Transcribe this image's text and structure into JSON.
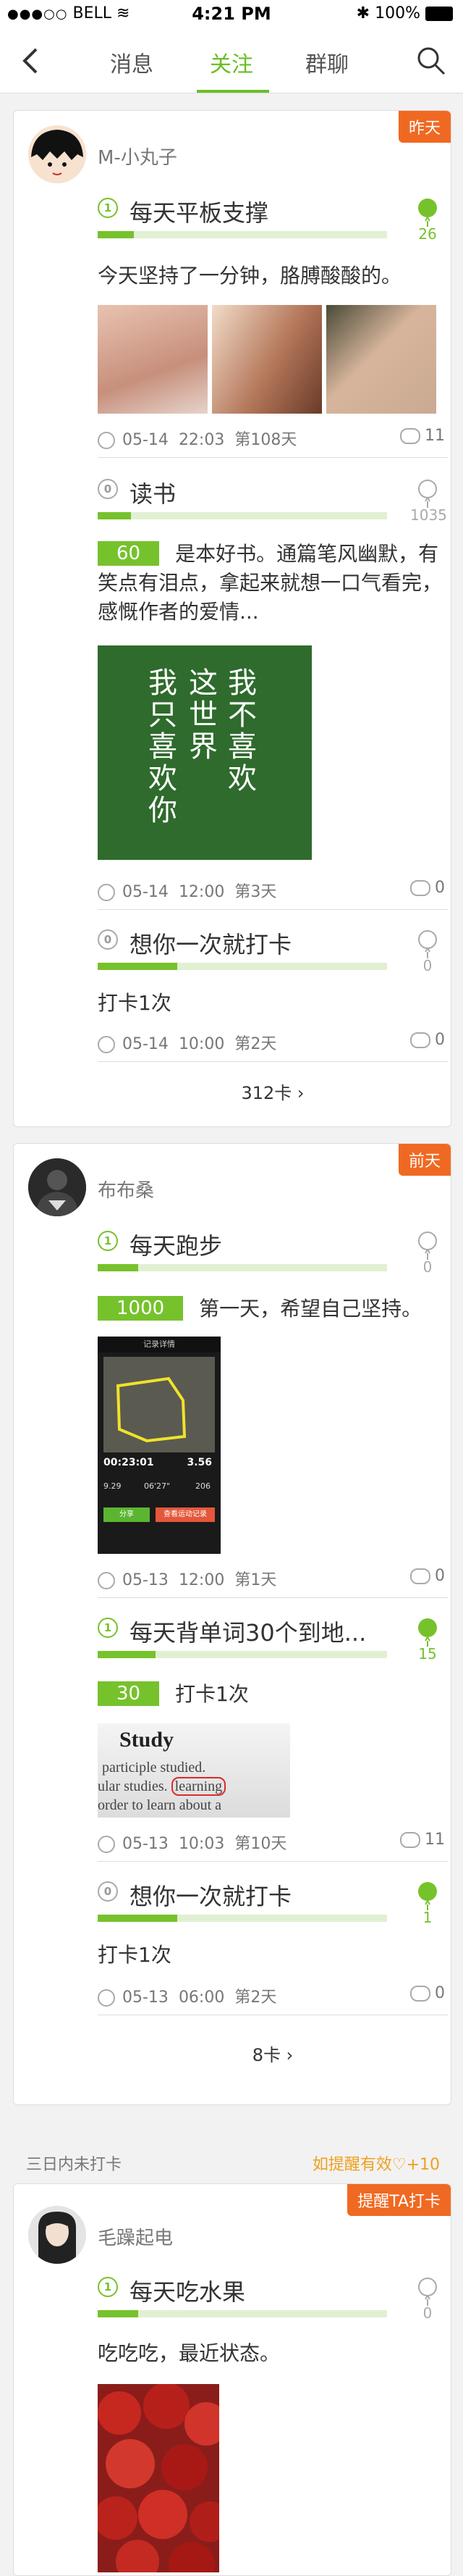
{
  "status_bar": {
    "carrier": "BELL",
    "time": "4:21 PM",
    "battery": "100%"
  },
  "nav": {
    "tabs": [
      "消息",
      "关注",
      "群聊"
    ],
    "active_tab": 1
  },
  "cards": [
    {
      "user": "M-小丸子",
      "badge": "昨天",
      "goals": [
        {
          "title": "每天平板支撑",
          "likes": "26",
          "text": "今天坚持了一分钟，胳膊酸酸的。",
          "date": "05-14",
          "time": "22:03",
          "day": "第108天",
          "comments": "11"
        },
        {
          "title": "读书",
          "likes": "1035",
          "tag": "60",
          "text": "是本好书。通篇笔风幽默，有笑点有泪点，拿起来就想一口气看完，感慨作者的爱情...",
          "date": "05-14",
          "time": "12:00",
          "day": "第3天",
          "comments": "0",
          "book_art": {
            "col1": "我只喜欢你",
            "col2": "这世界",
            "col3": "我不喜欢"
          }
        },
        {
          "title": "想你一次就打卡",
          "likes": "0",
          "text": "打卡1次",
          "date": "05-14",
          "time": "10:00",
          "day": "第2天",
          "comments": "0"
        }
      ],
      "more": "312卡"
    },
    {
      "user": "布布桑",
      "badge": "前天",
      "goals": [
        {
          "title": "每天跑步",
          "likes": "0",
          "tag": "1000",
          "text": "第一天，希望自己坚持。",
          "date": "05-13",
          "time": "12:00",
          "day": "第1天",
          "comments": "0",
          "run_screen": {
            "title": "记录详情",
            "duration": "00:23:01",
            "distance": "3.56",
            "pace": "9.29",
            "speed": "06'27\"",
            "calories": "206",
            "button_a": "分享",
            "button_b": "查看运动记录"
          }
        },
        {
          "title": "每天背单词30个到地...",
          "likes": "15",
          "tag": "30",
          "text": "打卡1次",
          "date": "05-13",
          "time": "10:03",
          "day": "第10天",
          "comments": "11",
          "study_words": {
            "heading": "Study",
            "line1": "participle studied.",
            "line2": "ular studies.",
            "highlight": "learning",
            "line3": "order to learn about a"
          }
        },
        {
          "title": "想你一次就打卡",
          "likes": "1",
          "text": "打卡1次",
          "date": "05-13",
          "time": "06:00",
          "day": "第2天",
          "comments": "0"
        }
      ],
      "more": "8卡"
    },
    {
      "section_label": "三日内未打卡",
      "section_right": "如提醒有效",
      "section_right_bonus": "+10",
      "user": "毛躁起电",
      "badge": "提醒TA打卡",
      "goals": [
        {
          "title": "每天吃水果",
          "likes": "0",
          "text": "吃吃吃，最近状态。"
        }
      ]
    }
  ],
  "colors": {
    "accent": "#6bbe24",
    "badge": "#f06922"
  }
}
